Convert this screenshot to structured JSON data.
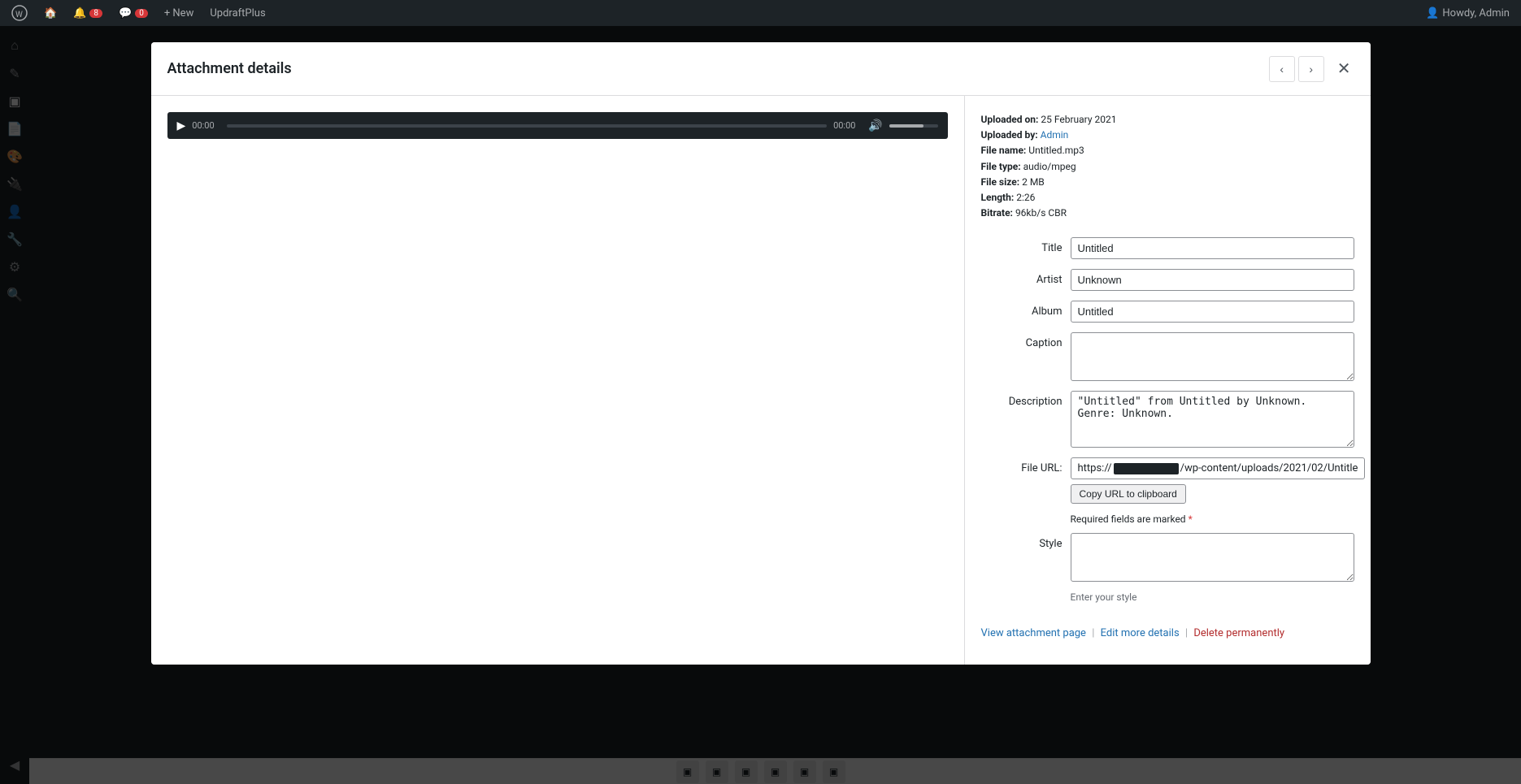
{
  "adminBar": {
    "wpLogoTitle": "WordPress",
    "siteTitle": "",
    "updateCount": "8",
    "commentsCount": "0",
    "newLabel": "+ New",
    "pluginLabel": "UpdraftPlus",
    "adminLabel": "Howdy, Admin"
  },
  "sidebar": {
    "icons": [
      {
        "name": "dashboard-icon",
        "symbol": "⌂"
      },
      {
        "name": "posts-icon",
        "symbol": "✎"
      },
      {
        "name": "media-icon",
        "symbol": "▣"
      },
      {
        "name": "library-icon",
        "symbol": "📚"
      },
      {
        "name": "appearance-icon",
        "symbol": "🎨"
      },
      {
        "name": "plugins-icon",
        "symbol": "🔌"
      },
      {
        "name": "users-icon",
        "symbol": "👤"
      },
      {
        "name": "tools-icon",
        "symbol": "🔧"
      },
      {
        "name": "settings-icon",
        "symbol": "⚙"
      },
      {
        "name": "search-icon",
        "symbol": "🔍"
      },
      {
        "name": "collapse-icon",
        "symbol": "◀"
      }
    ]
  },
  "modal": {
    "title": "Attachment details",
    "prevLabel": "‹",
    "nextLabel": "›",
    "closeLabel": "✕",
    "audio": {
      "playLabel": "▶",
      "currentTime": "00:00",
      "duration": "00:00"
    },
    "meta": {
      "uploadedOnLabel": "Uploaded on:",
      "uploadedOnValue": "25 February 2021",
      "uploadedByLabel": "Uploaded by:",
      "uploadedByValue": "Admin",
      "fileNameLabel": "File name:",
      "fileNameValue": "Untitled.mp3",
      "fileTypeLabel": "File type:",
      "fileTypeValue": "audio/mpeg",
      "fileSizeLabel": "File size:",
      "fileSizeValue": "2 MB",
      "lengthLabel": "Length:",
      "lengthValue": "2:26",
      "bitrateLabel": "Bitrate:",
      "bitrateValue": "96kb/s CBR"
    },
    "fields": {
      "titleLabel": "Title",
      "titleValue": "Untitled",
      "artistLabel": "Artist",
      "artistValue": "Unknown",
      "albumLabel": "Album",
      "albumValue": "Untitled",
      "captionLabel": "Caption",
      "captionValue": "",
      "captionPlaceholder": "",
      "descriptionLabel": "Description",
      "descriptionValue": "\"Untitled\" from Untitled by Unknown. Genre: Unknown.",
      "fileUrlLabel": "File URL:",
      "fileUrlPrefix": "https://",
      "fileUrlSuffix": "/wp-content/uploads/2021/02/Untitle",
      "copyUrlLabel": "Copy URL to clipboard",
      "requiredNotice": "Required fields are marked",
      "requiredStar": "*",
      "styleLabel": "Style",
      "styleValue": "",
      "styleHint": "Enter your style"
    },
    "footer": {
      "viewAttachmentLabel": "View attachment page",
      "editMoreLabel": "Edit more details",
      "deleteLabel": "Delete permanently",
      "sep1": "|",
      "sep2": "|"
    }
  }
}
